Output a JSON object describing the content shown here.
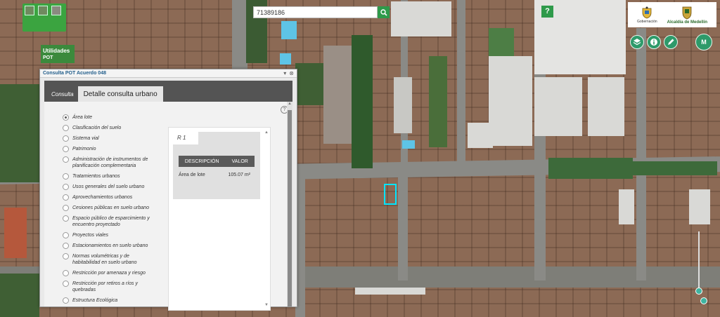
{
  "search": {
    "value": "71389186"
  },
  "utilidades": {
    "label": "Utilidades",
    "sub": "POT"
  },
  "help_top": {
    "label": "?"
  },
  "logos": {
    "left_label": "Gobernación",
    "right_label": "Alcaldía de Medellín"
  },
  "tools": {
    "m_label": "M"
  },
  "dialog": {
    "title": "Consulta POT Acuerdo 048",
    "tabs": [
      {
        "label": "Consulta"
      },
      {
        "label": "Detalle consulta urbano"
      }
    ],
    "options": [
      "Área lote",
      "Clasificación del suelo",
      "Sistema vial",
      "Patrimonio",
      "Administración de instrumentos de planificación complementaria",
      "Tratamientos urbanos",
      "Usos generales del suelo urbano",
      "Aprovechamientos urbanos",
      "Cesiones públicas en suelo urbano",
      "Espacio público de esparcimiento y encuentro proyectado",
      "Proyectos viales",
      "Estacionamientos en suelo urbano",
      "Normas volumétricas y de habitabilidad en suelo urbano",
      "Restricción por amenaza y riesgo",
      "Restricción por retiros a ríos y quebradas",
      "Estructura Ecológica"
    ],
    "result": {
      "tab": "R 1",
      "headers": [
        "DESCRIPCIÓN",
        "VALOR"
      ],
      "row": {
        "desc": "Área de lote",
        "value": "105.07 m²"
      }
    }
  },
  "colors": {
    "accent": "#2e9a4a",
    "highlight": "#00e5ff"
  }
}
